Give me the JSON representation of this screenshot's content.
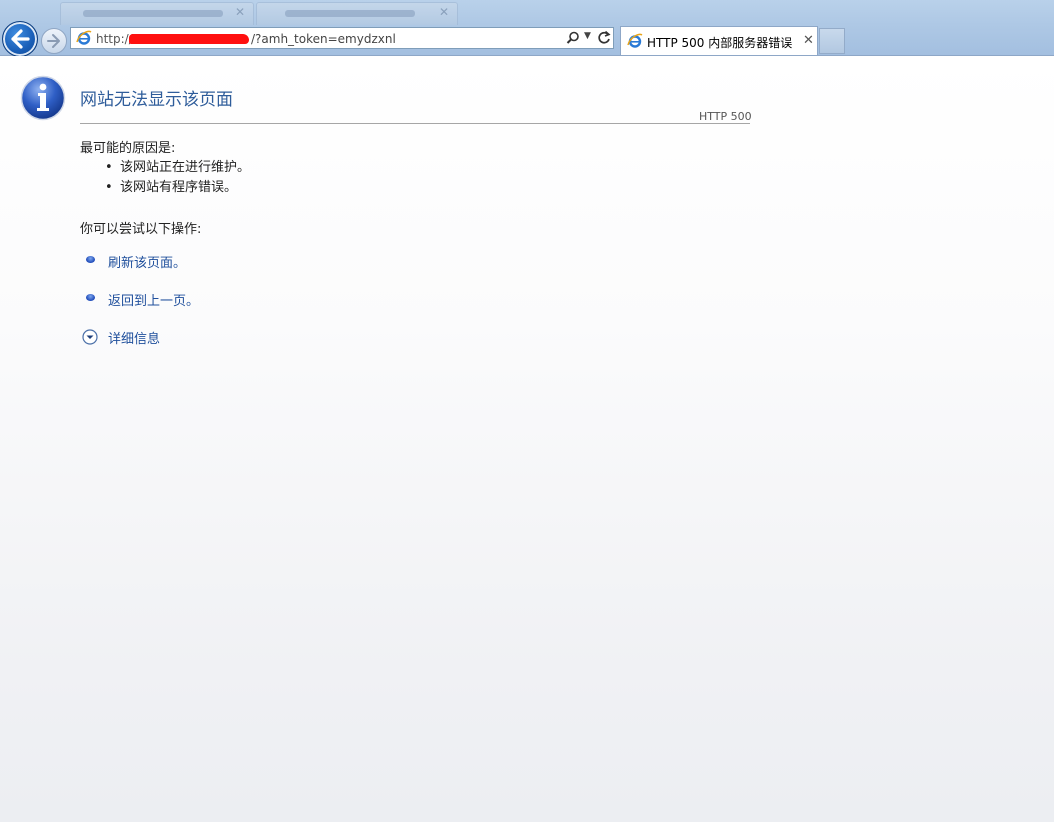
{
  "browser": {
    "url_prefix": "http://",
    "url_suffix": "/?amh_token=emydzxnl",
    "active_tab_title": "HTTP 500 内部服务器错误",
    "tab_close_glyph": "✕",
    "icons": [
      "back-arrow-icon",
      "forward-arrow-icon",
      "ie-logo-icon",
      "search-icon",
      "dropdown-arrow-icon",
      "refresh-icon"
    ]
  },
  "page": {
    "title": "网站无法显示该页面",
    "error_code": "HTTP 500",
    "causes_heading": "最可能的原因是:",
    "causes": [
      "该网站正在进行维护。",
      "该网站有程序错误。"
    ],
    "try_heading": "你可以尝试以下操作:",
    "actions": {
      "refresh": "刷新该页面。",
      "back": "返回到上一页。",
      "details": "详细信息"
    }
  },
  "colors": {
    "link": "#1f4f9c",
    "title": "#2e5c9a",
    "redaction": "#ff1010"
  }
}
